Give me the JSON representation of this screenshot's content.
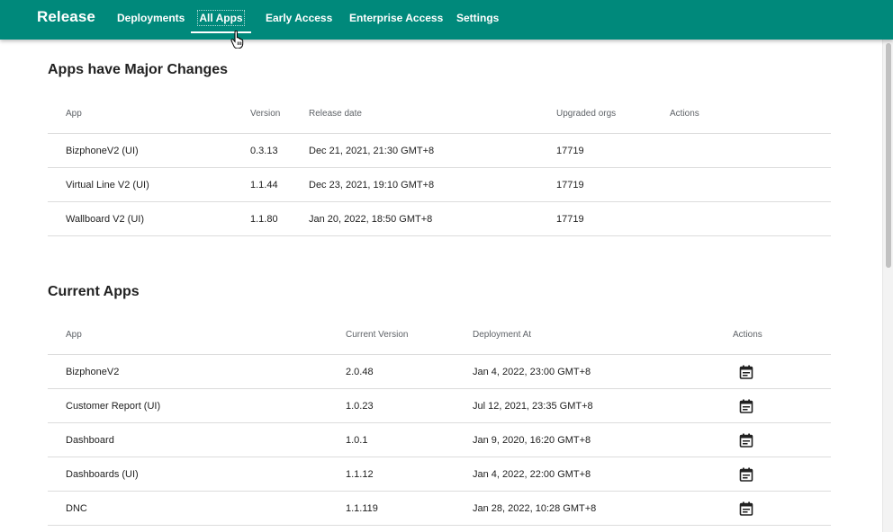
{
  "app": {
    "brand": "Release",
    "nav": [
      "Deployments",
      "All Apps",
      "Early Access",
      "Enterprise Access",
      "Settings"
    ],
    "active_tab": "All Apps",
    "accent_color": "#00897b"
  },
  "major_changes": {
    "title": "Apps have Major Changes",
    "columns": [
      "App",
      "Version",
      "Release date",
      "Upgraded orgs",
      "Actions"
    ],
    "rows": [
      {
        "app": "BizphoneV2 (UI)",
        "version": "0.3.13",
        "release_date": "Dec 21, 2021, 21:30 GMT+8",
        "upgraded_orgs": "17719"
      },
      {
        "app": "Virtual Line V2 (UI)",
        "version": "1.1.44",
        "release_date": "Dec 23, 2021, 19:10 GMT+8",
        "upgraded_orgs": "17719"
      },
      {
        "app": "Wallboard V2 (UI)",
        "version": "1.1.80",
        "release_date": "Jan 20, 2022, 18:50 GMT+8",
        "upgraded_orgs": "17719"
      }
    ]
  },
  "current_apps": {
    "title": "Current Apps",
    "columns": [
      "App",
      "Current Version",
      "Deployment At",
      "Actions"
    ],
    "action_icon": "calendar-icon",
    "rows": [
      {
        "app": "BizphoneV2",
        "version": "2.0.48",
        "deployment_at": "Jan 4, 2022, 23:00 GMT+8"
      },
      {
        "app": "Customer Report (UI)",
        "version": "1.0.23",
        "deployment_at": "Jul 12, 2021, 23:35 GMT+8"
      },
      {
        "app": "Dashboard",
        "version": "1.0.1",
        "deployment_at": "Jan 9, 2020, 16:20 GMT+8"
      },
      {
        "app": "Dashboards (UI)",
        "version": "1.1.12",
        "deployment_at": "Jan 4, 2022, 22:00 GMT+8"
      },
      {
        "app": "DNC",
        "version": "1.1.119",
        "deployment_at": "Jan 28, 2022, 10:28 GMT+8"
      }
    ]
  }
}
